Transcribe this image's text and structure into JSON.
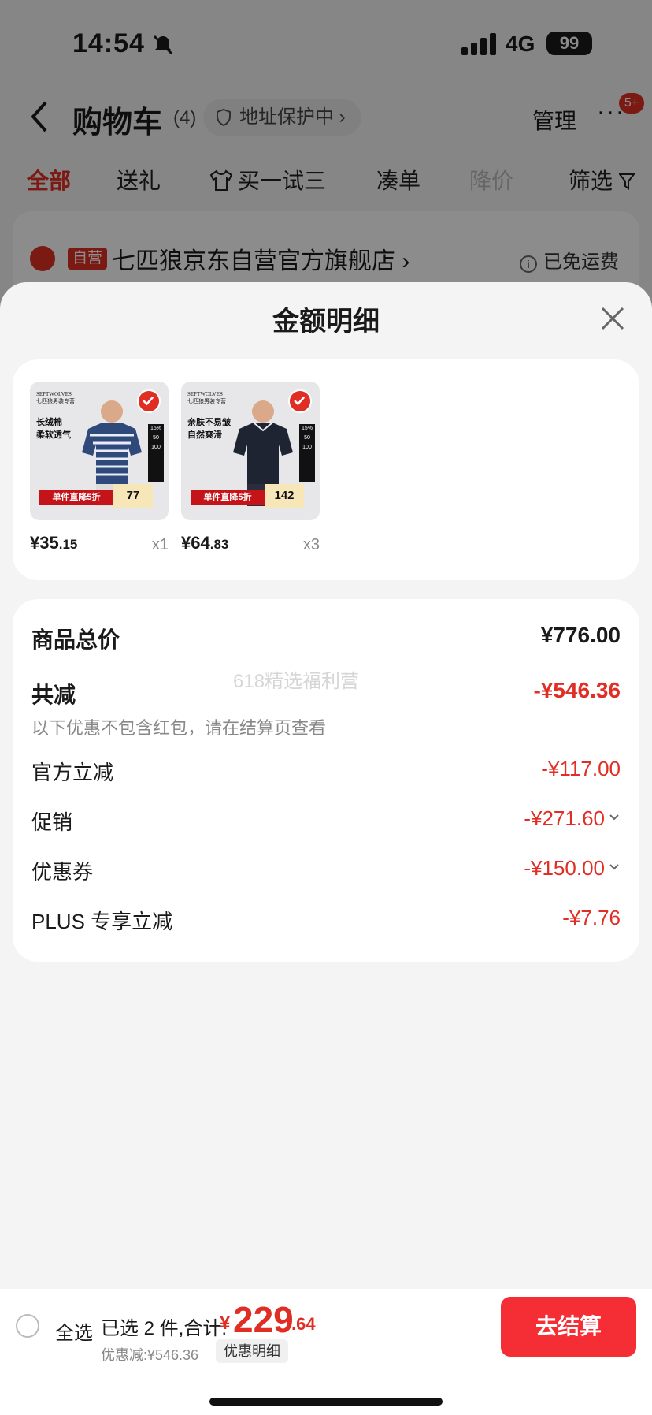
{
  "status_bar": {
    "time": "14:54",
    "network": "4G",
    "battery": "99"
  },
  "nav": {
    "title": "购物车",
    "count": "(4)",
    "address": "地址保护中 ›",
    "manage": "管理",
    "more": "···",
    "badge": "5+"
  },
  "tabs": [
    {
      "label": "全部"
    },
    {
      "label": "送礼"
    },
    {
      "label": "买一试三"
    },
    {
      "label": "凑单"
    },
    {
      "label": "降价"
    },
    {
      "label": "筛选"
    }
  ],
  "store": {
    "tag": "自营",
    "name": "七匹狼京东自营官方旗舰店 ›",
    "shipping": "已免运费",
    "info": "i"
  },
  "sheet": {
    "title": "金额明细"
  },
  "products": [
    {
      "brand": "SEPTWOLVES\n七匹狼男装专营",
      "features": "长绒棉\n柔软透气",
      "strip": "单件直降5折",
      "box_price": "77",
      "price_int": "¥35",
      "price_dec": ".15",
      "qty": "x1",
      "side": "15%\n50\n100",
      "color": "#2f4a7a"
    },
    {
      "brand": "SEPTWOLVES\n七匹狼男装专营",
      "features": "亲肤不易皱\n自然爽滑",
      "strip": "单件直降5折",
      "box_price": "142",
      "price_int": "¥64",
      "price_dec": ".83",
      "qty": "x3",
      "side": "15%\n50\n100",
      "color": "#1f2433"
    }
  ],
  "details": {
    "total_label": "商品总价",
    "total_value": "¥776.00",
    "reduce_label": "共减",
    "reduce_value": "-¥546.36",
    "note": "以下优惠不包含红包，请在结算页查看",
    "watermark": "618精选福利营",
    "items": [
      {
        "label": "官方立减",
        "value": "-¥117.00",
        "chevron": false
      },
      {
        "label": "促销",
        "value": "-¥271.60",
        "chevron": true
      },
      {
        "label": "优惠券",
        "value": "-¥150.00",
        "chevron": true
      },
      {
        "label": "PLUS 专享立减",
        "value": "-¥7.76",
        "chevron": false
      }
    ]
  },
  "bottom": {
    "select_all": "全选",
    "selected": "已选 2 件,合计:",
    "currency": "¥",
    "total_int": "229",
    "total_dec": ".64",
    "discount": "优惠减:¥546.36",
    "detail_btn": "优惠明细",
    "checkout": "去结算"
  },
  "colors": {
    "accent": "#e02e24",
    "checkout": "#f52e36"
  }
}
